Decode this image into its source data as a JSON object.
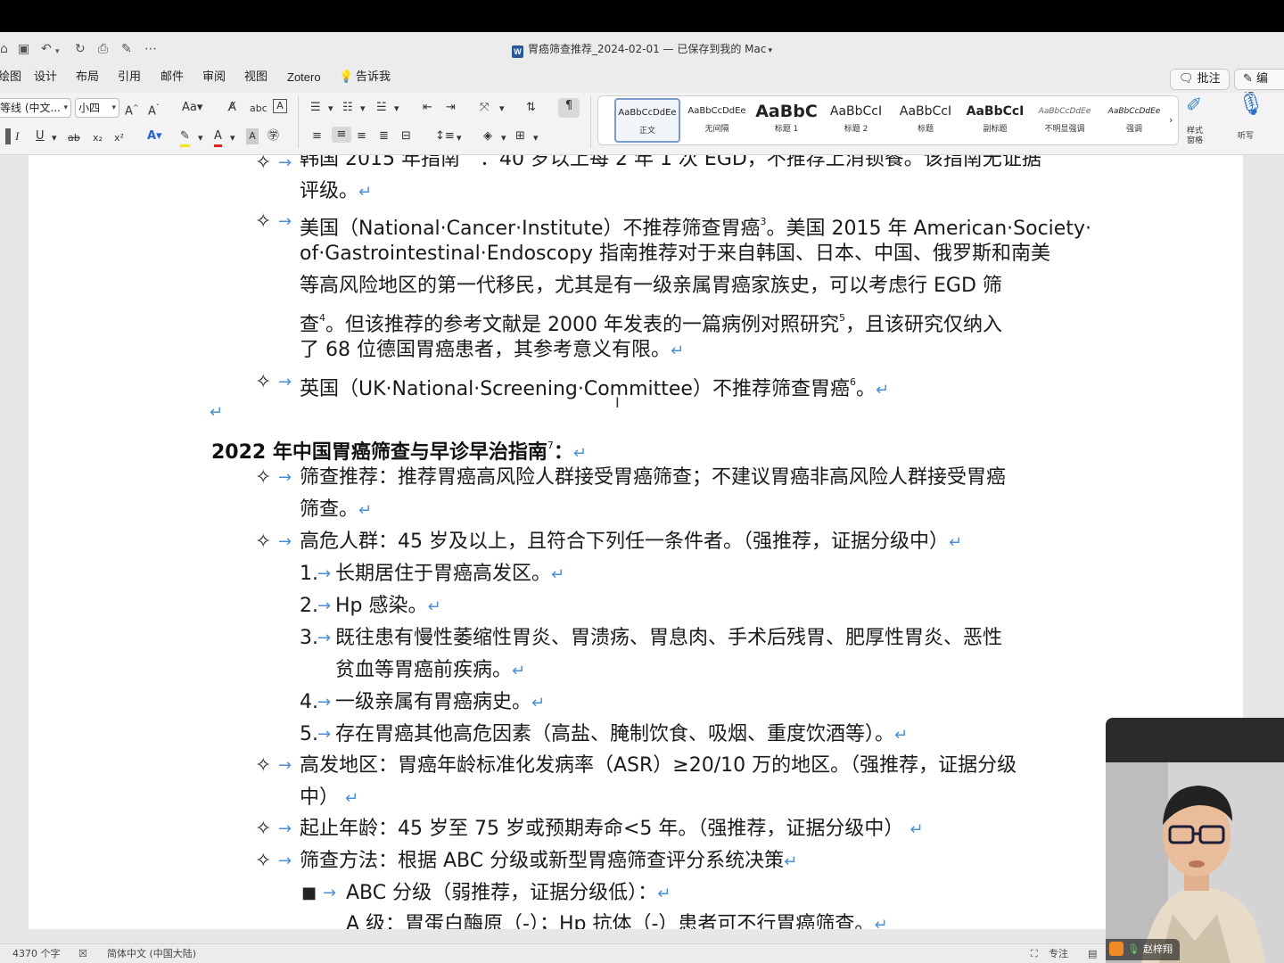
{
  "window": {
    "doc_title": "胃癌筛查推荐_2024-02-01 — 已保存到我的 Mac",
    "word_icon": "W"
  },
  "tabs": [
    "绘图",
    "设计",
    "布局",
    "引用",
    "邮件",
    "审阅",
    "视图",
    "Zotero",
    "告诉我"
  ],
  "actions": {
    "comments": "批注",
    "editing": "编辑"
  },
  "ribbon": {
    "font_name": "等线 (中文...",
    "font_size": "小四",
    "styles": [
      {
        "sample": "AaBbCcDdEe",
        "name": "正文"
      },
      {
        "sample": "AaBbCcDdEe",
        "name": "无间隔"
      },
      {
        "sample": "AaBbC",
        "name": "标题 1"
      },
      {
        "sample": "AaBbCcI",
        "name": "标题 2"
      },
      {
        "sample": "AaBbCcI",
        "name": "标题"
      },
      {
        "sample": "AaBbCcI",
        "name": "副标题"
      },
      {
        "sample": "AaBbCcDdEe",
        "name": "不明显强调"
      },
      {
        "sample": "AaBbCcDdEe",
        "name": "强调"
      }
    ],
    "styles_pane": "样式\n窗格",
    "dictate": "听写"
  },
  "doc": {
    "top_partial_1": "韩国 2015 年指南　：40 岁以上每 2 年 1 次 EGD，不推荐上消钡餐。该指南无证据",
    "top_partial_2": "评级。",
    "us_1a": "美国（National·Cancer·Institute）不推荐筛查胃癌",
    "us_1b": "。美国 2015 年 American·Society·",
    "ref3": "3",
    "us_2": "of·Gastrointestinal·Endoscopy 指南推荐对于来自韩国、日本、中国、俄罗斯和南美",
    "us_3": "等高风险地区的第一代移民，尤其是有一级亲属胃癌家族史，可以考虑行 EGD 筛",
    "us_4a": "查",
    "ref4": "4",
    "us_4b": "。但该推荐的参考文献是 2000 年发表的一篇病例对照研究",
    "ref5": "5",
    "us_4c": "，且该研究仅纳入",
    "us_5": "了 68 位德国胃癌患者，其参考意义有限。",
    "uk_a": "英国（UK·National·Screening·Committee）不推荐筛查胃癌",
    "ref6": "6",
    "uk_b": "。",
    "heading_a": "2022 年中国胃癌筛查与早诊早治指南",
    "ref7": "7",
    "heading_b": "：",
    "rec_1": "筛查推荐：推荐胃癌高风险人群接受胃癌筛查；不建议胃癌非高风险人群接受胃癌",
    "rec_2": "筛查。",
    "risk": "高危人群：45 岁及以上，且符合下列任一条件者。（强推荐，证据分级中）",
    "items": [
      {
        "num": "1.",
        "text": "长期居住于胃癌高发区。"
      },
      {
        "num": "2.",
        "text": "Hp 感染。"
      },
      {
        "num": "3.",
        "text": "既往患有慢性萎缩性胃炎、胃溃疡、胃息肉、手术后残胃、肥厚性胃炎、恶性"
      },
      {
        "num": "",
        "text": "贫血等胃癌前疾病。"
      },
      {
        "num": "4.",
        "text": "一级亲属有胃癌病史。"
      },
      {
        "num": "5.",
        "text": "存在胃癌其他高危因素（高盐、腌制饮食、吸烟、重度饮酒等）。"
      }
    ],
    "area_1": "高发地区：胃癌年龄标准化发病率（ASR）≥20/10 万的地区。（强推荐，证据分级",
    "area_2": "中）",
    "age": "起止年龄：45 岁至 75 岁或预期寿命<5 年。（强推荐，证据分级中）",
    "method": "筛查方法：根据 ABC 分级或新型胃癌筛查评分系统决策",
    "abc": "ABC 分级（弱推荐，证据分级低）：",
    "abc_a": "A 级：胃蛋白酶原（-）；Hp 抗体（-）患者可不行胃癌筛查。"
  },
  "status": {
    "word_count": "4370 个字",
    "language": "简体中文 (中国大陆)",
    "focus": "专注"
  },
  "video": {
    "participant": "赵梓翔"
  },
  "marks": {
    "para": "↵",
    "tab": "→",
    "bullet": "✧",
    "square": "■"
  }
}
